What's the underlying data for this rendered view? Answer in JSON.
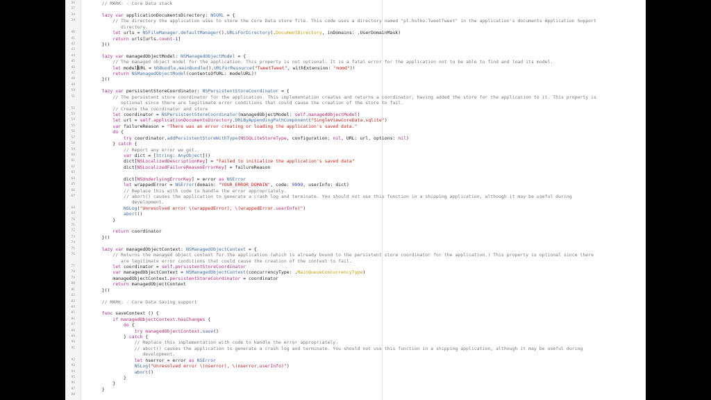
{
  "editor": {
    "lines": [
      {
        "n": "36",
        "t": [
          {
            "s": "    // MARK: - Core Data stack",
            "c": "cm"
          }
        ]
      },
      {
        "n": "37",
        "t": []
      },
      {
        "n": "38",
        "t": [
          {
            "s": "    lazy var ",
            "c": "kw"
          },
          {
            "s": "applicationDocumentsDirectory: "
          },
          {
            "s": "NSURL",
            "c": "ty"
          },
          {
            "s": " = {"
          }
        ]
      },
      {
        "n": "39",
        "t": [
          {
            "s": "        // The directory the application uses to store the Core Data store file. This code uses a directory named \"pl.holko.TweetTweet\" in the application's documents Application Support",
            "c": "cm"
          }
        ]
      },
      {
        "n": "",
        "t": [
          {
            "s": "           directory.",
            "c": "cm"
          }
        ]
      },
      {
        "n": "40",
        "t": [
          {
            "s": "        let ",
            "c": "kw"
          },
          {
            "s": "urls = "
          },
          {
            "s": "NSFileManager",
            "c": "ty"
          },
          {
            "s": "."
          },
          {
            "s": "defaultManager",
            "c": "fn"
          },
          {
            "s": "()."
          },
          {
            "s": "URLsForDirectory",
            "c": "fn"
          },
          {
            "s": "(."
          },
          {
            "s": "DocumentDirectory",
            "c": "en"
          },
          {
            "s": ", inDomains: ."
          },
          {
            "s": "UserDomainMask"
          },
          {
            "s": ")"
          }
        ]
      },
      {
        "n": "41",
        "t": [
          {
            "s": "        return ",
            "c": "kw"
          },
          {
            "s": "urls[urls."
          },
          {
            "s": "count",
            "c": "pr"
          },
          {
            "s": "-"
          },
          {
            "s": "1",
            "c": "num"
          },
          {
            "s": "]"
          }
        ]
      },
      {
        "n": "42",
        "t": [
          {
            "s": "    }()"
          }
        ]
      },
      {
        "n": "43",
        "t": []
      },
      {
        "n": "44",
        "t": [
          {
            "s": "    lazy var ",
            "c": "kw"
          },
          {
            "s": "managedObjectModel: "
          },
          {
            "s": "NSManagedObjectModel",
            "c": "ty"
          },
          {
            "s": " = {"
          }
        ]
      },
      {
        "n": "45",
        "t": [
          {
            "s": "        // The managed object model for the application. This property is not optional. It is a fatal error for the application not to be able to find and load its model.",
            "c": "cm"
          }
        ]
      },
      {
        "n": "46",
        "t": [
          {
            "s": "        let ",
            "c": "kw"
          },
          {
            "s": "model"
          },
          {
            "cursor": true
          },
          {
            "s": "URL = "
          },
          {
            "s": "NSBundle",
            "c": "ty"
          },
          {
            "s": "."
          },
          {
            "s": "mainBundle",
            "c": "fn"
          },
          {
            "s": "()."
          },
          {
            "s": "URLForResource",
            "c": "fn"
          },
          {
            "s": "("
          },
          {
            "s": "\"TweetTweet\"",
            "c": "str"
          },
          {
            "s": ", withExtension: "
          },
          {
            "s": "\"momd\"",
            "c": "str"
          },
          {
            "s": ")!"
          }
        ]
      },
      {
        "n": "47",
        "t": [
          {
            "s": "        return ",
            "c": "kw"
          },
          {
            "s": "NSManagedObjectModel",
            "c": "ty"
          },
          {
            "s": "(contentsOfURL: modelURL)!"
          }
        ]
      },
      {
        "n": "48",
        "t": [
          {
            "s": "    }()"
          }
        ]
      },
      {
        "n": "49",
        "t": []
      },
      {
        "n": "50",
        "t": [
          {
            "s": "    lazy var ",
            "c": "kw"
          },
          {
            "s": "persistentStoreCoordinator: "
          },
          {
            "s": "NSPersistentStoreCoordinator",
            "c": "ty"
          },
          {
            "s": " = {"
          }
        ]
      },
      {
        "n": "51",
        "t": [
          {
            "s": "        // The persistent store coordinator for the application. This implementation creates and returns a coordinator, having added the store for the application to it. This property is",
            "c": "cm"
          }
        ]
      },
      {
        "n": "",
        "t": [
          {
            "s": "           optional since there are legitimate error conditions that could cause the creation of the store to fail.",
            "c": "cm"
          }
        ]
      },
      {
        "n": "52",
        "t": [
          {
            "s": "        // Create the coordinator and store",
            "c": "cm"
          }
        ]
      },
      {
        "n": "53",
        "t": [
          {
            "s": "        let ",
            "c": "kw"
          },
          {
            "s": "coordinator = "
          },
          {
            "s": "NSPersistentStoreCoordinator",
            "c": "ty"
          },
          {
            "s": "(managedObjectModel: "
          },
          {
            "s": "self",
            "c": "kw"
          },
          {
            "s": "."
          },
          {
            "s": "managedObjectModel",
            "c": "pr"
          },
          {
            "s": ")"
          }
        ]
      },
      {
        "n": "54",
        "t": [
          {
            "s": "        let ",
            "c": "kw"
          },
          {
            "s": "url = "
          },
          {
            "s": "self",
            "c": "kw"
          },
          {
            "s": "."
          },
          {
            "s": "applicationDocumentsDirectory",
            "c": "pr"
          },
          {
            "s": "."
          },
          {
            "s": "URLByAppendingPathComponent",
            "c": "fn"
          },
          {
            "s": "("
          },
          {
            "s": "\"SingleViewCoreData.sqlite\"",
            "c": "str"
          },
          {
            "s": ")"
          }
        ]
      },
      {
        "n": "55",
        "t": [
          {
            "s": "        var ",
            "c": "kw"
          },
          {
            "s": "failureReason = "
          },
          {
            "s": "\"There was an error creating or loading the application's saved data.\"",
            "c": "str"
          }
        ]
      },
      {
        "n": "56",
        "t": [
          {
            "s": "        do ",
            "c": "kw"
          },
          {
            "s": "{"
          }
        ]
      },
      {
        "n": "57",
        "t": [
          {
            "s": "            try ",
            "c": "kw"
          },
          {
            "s": "coordinator."
          },
          {
            "s": "addPersistentStoreWithType",
            "c": "fn"
          },
          {
            "s": "("
          },
          {
            "s": "NSSQLiteStoreType",
            "c": "pr"
          },
          {
            "s": ", configuration: "
          },
          {
            "s": "nil",
            "c": "kw"
          },
          {
            "s": ", URL: url, options: "
          },
          {
            "s": "nil",
            "c": "kw"
          },
          {
            "s": ")"
          }
        ]
      },
      {
        "n": "58",
        "t": [
          {
            "s": "        } "
          },
          {
            "s": "catch ",
            "c": "kw"
          },
          {
            "s": "{"
          }
        ]
      },
      {
        "n": "59",
        "t": [
          {
            "s": "            // Report any error we got.",
            "c": "cm"
          }
        ]
      },
      {
        "n": "60",
        "t": [
          {
            "s": "            var ",
            "c": "kw"
          },
          {
            "s": "dict = ["
          },
          {
            "s": "String",
            "c": "ty"
          },
          {
            "s": ": "
          },
          {
            "s": "AnyObject",
            "c": "ty"
          },
          {
            "s": "]()"
          }
        ]
      },
      {
        "n": "61",
        "t": [
          {
            "s": "            dict["
          },
          {
            "s": "NSLocalizedDescriptionKey",
            "c": "pr"
          },
          {
            "s": "] = "
          },
          {
            "s": "\"Failed to initialize the application's saved data\"",
            "c": "str"
          }
        ]
      },
      {
        "n": "62",
        "t": [
          {
            "s": "            dict["
          },
          {
            "s": "NSLocalizedFailureReasonErrorKey",
            "c": "pr"
          },
          {
            "s": "] = failureReason"
          }
        ]
      },
      {
        "n": "63",
        "t": []
      },
      {
        "n": "64",
        "t": [
          {
            "s": "            dict["
          },
          {
            "s": "NSUnderlyingErrorKey",
            "c": "pr"
          },
          {
            "s": "] = error "
          },
          {
            "s": "as ",
            "c": "kw"
          },
          {
            "s": "NSError",
            "c": "ty"
          }
        ]
      },
      {
        "n": "65",
        "t": [
          {
            "s": "            let ",
            "c": "kw"
          },
          {
            "s": "wrappedError = "
          },
          {
            "s": "NSError",
            "c": "ty"
          },
          {
            "s": "(domain: "
          },
          {
            "s": "\"YOUR_ERROR_DOMAIN\"",
            "c": "str"
          },
          {
            "s": ", code: "
          },
          {
            "s": "9999",
            "c": "num"
          },
          {
            "s": ", userInfo: dict)"
          }
        ]
      },
      {
        "n": "66",
        "t": [
          {
            "s": "            // Replace this with code to handle the error appropriately.",
            "c": "cm"
          }
        ]
      },
      {
        "n": "67",
        "t": [
          {
            "s": "            // abort() causes the application to generate a crash log and terminate. You should not use this function in a shipping application, although it may be useful during",
            "c": "cm"
          }
        ]
      },
      {
        "n": "",
        "t": [
          {
            "s": "               development.",
            "c": "cm"
          }
        ]
      },
      {
        "n": "68",
        "t": [
          {
            "s": "            "
          },
          {
            "s": "NSLog",
            "c": "fn"
          },
          {
            "s": "("
          },
          {
            "s": "\"Unresolved error \\(wrappedError), \\(wrappedError.",
            "c": "str"
          },
          {
            "s": "userInfo",
            "c": "pr"
          },
          {
            "s": ")\"",
            "c": "str"
          },
          {
            "s": ")"
          }
        ]
      },
      {
        "n": "69",
        "t": [
          {
            "s": "            "
          },
          {
            "s": "abort",
            "c": "fn"
          },
          {
            "s": "()"
          }
        ]
      },
      {
        "n": "70",
        "t": [
          {
            "s": "        }"
          }
        ]
      },
      {
        "n": "71",
        "t": []
      },
      {
        "n": "72",
        "t": [
          {
            "s": "        return ",
            "c": "kw"
          },
          {
            "s": "coordinator"
          }
        ]
      },
      {
        "n": "73",
        "t": [
          {
            "s": "    }()"
          }
        ]
      },
      {
        "n": "74",
        "t": []
      },
      {
        "n": "75",
        "t": [
          {
            "s": "    lazy var ",
            "c": "kw"
          },
          {
            "s": "managedObjectContext: "
          },
          {
            "s": "NSManagedObjectContext",
            "c": "ty"
          },
          {
            "s": " = {"
          }
        ]
      },
      {
        "n": "76",
        "t": [
          {
            "s": "        // Returns the managed object context for the application (which is already bound to the persistent store coordinator for the application.) This property is optional since there",
            "c": "cm"
          }
        ]
      },
      {
        "n": "",
        "t": [
          {
            "s": "           are legitimate error conditions that could cause the creation of the context to fail.",
            "c": "cm"
          }
        ]
      },
      {
        "n": "77",
        "t": [
          {
            "s": "        let ",
            "c": "kw"
          },
          {
            "s": "coordinator = "
          },
          {
            "s": "self",
            "c": "kw"
          },
          {
            "s": "."
          },
          {
            "s": "persistentStoreCoordinator",
            "c": "pr"
          }
        ]
      },
      {
        "n": "78",
        "t": [
          {
            "s": "        var ",
            "c": "kw"
          },
          {
            "s": "managedObjectContext = "
          },
          {
            "s": "NSManagedObjectContext",
            "c": "ty"
          },
          {
            "s": "(concurrencyType: ."
          },
          {
            "s": "MainQueueConcurrencyType",
            "c": "en"
          },
          {
            "s": ")"
          }
        ]
      },
      {
        "n": "79",
        "t": [
          {
            "s": "        managedObjectContext."
          },
          {
            "s": "persistentStoreCoordinator",
            "c": "pr"
          },
          {
            "s": " = coordinator"
          }
        ]
      },
      {
        "n": "80",
        "t": [
          {
            "s": "        return ",
            "c": "kw"
          },
          {
            "s": "managedObjectContext"
          }
        ]
      },
      {
        "n": "81",
        "t": [
          {
            "s": "    }()"
          }
        ]
      },
      {
        "n": "82",
        "t": []
      },
      {
        "n": "83",
        "t": [
          {
            "s": "    // MARK: - Core Data Saving support",
            "c": "cm"
          }
        ]
      },
      {
        "n": "84",
        "t": []
      },
      {
        "n": "85",
        "t": [
          {
            "s": "    func ",
            "c": "kw"
          },
          {
            "s": "saveContext () {"
          }
        ]
      },
      {
        "n": "86",
        "t": [
          {
            "s": "        if ",
            "c": "kw"
          },
          {
            "s": "managedObjectContext",
            "c": "pr"
          },
          {
            "s": "."
          },
          {
            "s": "hasChanges",
            "c": "pr"
          },
          {
            "s": " {"
          }
        ]
      },
      {
        "n": "87",
        "t": [
          {
            "s": "            do ",
            "c": "kw"
          },
          {
            "s": "{"
          }
        ]
      },
      {
        "n": "88",
        "t": [
          {
            "s": "                try ",
            "c": "kw"
          },
          {
            "s": "managedObjectContext",
            "c": "pr"
          },
          {
            "s": "."
          },
          {
            "s": "save",
            "c": "fn"
          },
          {
            "s": "()"
          }
        ]
      },
      {
        "n": "89",
        "t": [
          {
            "s": "            } "
          },
          {
            "s": "catch ",
            "c": "kw"
          },
          {
            "s": "{"
          }
        ]
      },
      {
        "n": "90",
        "t": [
          {
            "s": "                // Replace this implementation with code to handle the error appropriately.",
            "c": "cm"
          }
        ]
      },
      {
        "n": "91",
        "t": [
          {
            "s": "                // abort() causes the application to generate a crash log and terminate. You should not use this function in a shipping application, although it may be useful during",
            "c": "cm"
          }
        ]
      },
      {
        "n": "",
        "t": [
          {
            "s": "                   development.",
            "c": "cm"
          }
        ]
      },
      {
        "n": "92",
        "t": [
          {
            "s": "                let ",
            "c": "kw"
          },
          {
            "s": "nserror = error "
          },
          {
            "s": "as ",
            "c": "kw"
          },
          {
            "s": "NSError",
            "c": "ty"
          }
        ]
      },
      {
        "n": "93",
        "t": [
          {
            "s": "                "
          },
          {
            "s": "NSLog",
            "c": "fn"
          },
          {
            "s": "("
          },
          {
            "s": "\"Unresolved error \\(nserror), \\(nserror.",
            "c": "str"
          },
          {
            "s": "userInfo",
            "c": "pr"
          },
          {
            "s": ")\"",
            "c": "str"
          },
          {
            "s": ")"
          }
        ]
      },
      {
        "n": "94",
        "t": [
          {
            "s": "                "
          },
          {
            "s": "abort",
            "c": "fn"
          },
          {
            "s": "()"
          }
        ]
      },
      {
        "n": "95",
        "t": [
          {
            "s": "            }"
          }
        ]
      },
      {
        "n": "96",
        "t": [
          {
            "s": "        }"
          }
        ]
      },
      {
        "n": "97",
        "t": [
          {
            "s": "    }"
          }
        ]
      },
      {
        "n": "98",
        "t": []
      }
    ]
  }
}
